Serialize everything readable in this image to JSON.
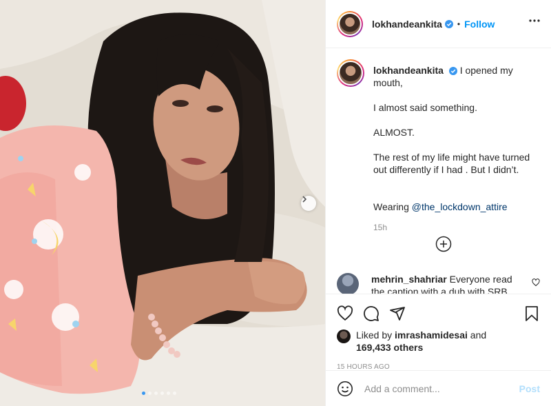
{
  "post": {
    "username": "lokhandeankita",
    "separator": "•",
    "follow_label": "Follow",
    "caption_lines": [
      "I opened my mouth,",
      "I almost said something.",
      "ALMOST.",
      "The rest of my life might have turned out differently if I had . But I didn’t."
    ],
    "wearing_prefix": "Wearing",
    "wearing_mention": "@the_lockdown_attire",
    "caption_time": "15h"
  },
  "comment": {
    "username": "mehrin_shahriar",
    "text": "Everyone read the caption with a dub with SRB"
  },
  "likes": {
    "prefix": "Liked by",
    "liker": "imrashamidesai",
    "and": "and",
    "others": "169,433 others"
  },
  "posted_ago": "15 HOURS AGO",
  "comment_box": {
    "placeholder": "Add a comment...",
    "post_label": "Post"
  },
  "carousel": {
    "slide_count": 6,
    "active_index": 0
  },
  "colors": {
    "follow_blue": "#0095f6",
    "verified_blue": "#3897f0",
    "post_disabled": "#b2dffc",
    "mention": "#00376b",
    "pajama_pink": "#f4b6ad"
  },
  "icons": [
    "verified-badge-icon",
    "more-options-icon",
    "add-comments-icon",
    "heart-icon",
    "comment-icon",
    "share-icon",
    "bookmark-icon",
    "emoji-icon",
    "chevron-right-icon"
  ]
}
